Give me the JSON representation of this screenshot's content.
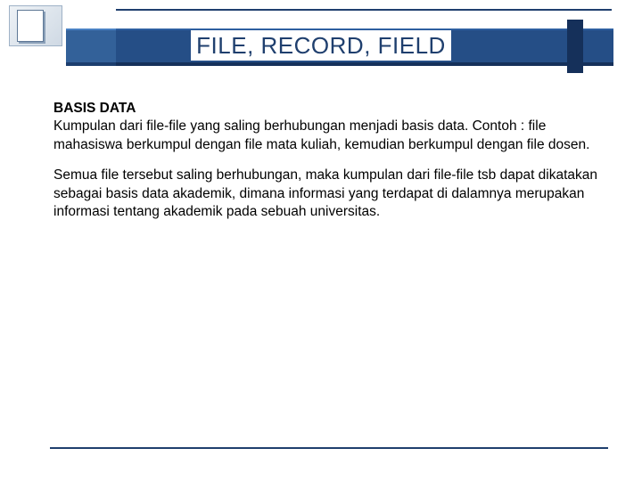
{
  "slide": {
    "title": "FILE, RECORD, FIELD",
    "section_heading": "BASIS DATA",
    "para1": "Kumpulan dari file-file yang saling berhubungan menjadi basis data. Contoh : file mahasiswa berkumpul dengan file mata kuliah, kemudian berkumpul dengan file dosen.",
    "para2": "Semua file tersebut saling berhubungan, maka kumpulan dari file-file tsb dapat dikatakan sebagai basis data akademik, dimana informasi yang terdapat di dalamnya merupakan informasi tentang akademik pada sebuah universitas."
  }
}
